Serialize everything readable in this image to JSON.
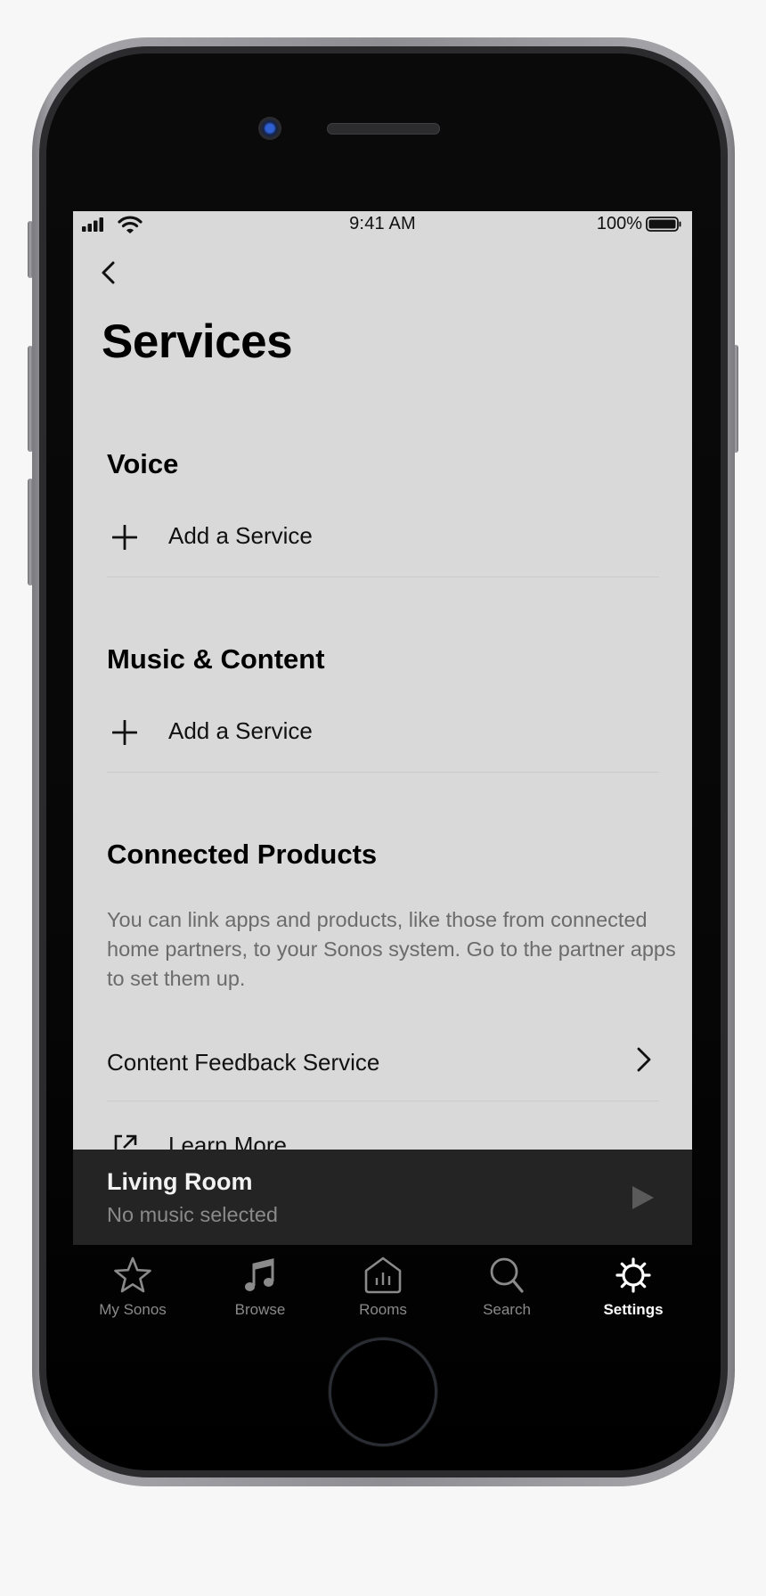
{
  "status_bar": {
    "time": "9:41 AM",
    "battery_percent": "100%",
    "signal_icon": "cellular-signal-icon",
    "wifi_icon": "wifi-icon",
    "battery_icon": "battery-full-icon"
  },
  "header": {
    "back_icon": "chevron-left-icon",
    "title": "Services"
  },
  "sections": {
    "voice": {
      "heading": "Voice",
      "add_label": "Add a Service",
      "add_icon": "plus-icon"
    },
    "music": {
      "heading": "Music & Content",
      "add_label": "Add a Service",
      "add_icon": "plus-icon"
    },
    "connected": {
      "heading": "Connected Products",
      "description": "You can link apps and products, like those from connected home partners, to your Sonos system. Go to the partner apps to set them up.",
      "items": [
        {
          "label": "Content Feedback Service",
          "icon": "chevron-right-icon"
        },
        {
          "label": "Learn More",
          "icon": "external-link-icon"
        }
      ]
    }
  },
  "mini_player": {
    "room": "Living Room",
    "status": "No music selected",
    "play_icon": "play-icon"
  },
  "tab_bar": {
    "tabs": [
      {
        "label": "My Sonos",
        "icon": "star-icon",
        "active": false
      },
      {
        "label": "Browse",
        "icon": "music-note-icon",
        "active": false
      },
      {
        "label": "Rooms",
        "icon": "rooms-house-icon",
        "active": false
      },
      {
        "label": "Search",
        "icon": "search-icon",
        "active": false
      },
      {
        "label": "Settings",
        "icon": "gear-icon",
        "active": true
      }
    ]
  },
  "colors": {
    "screen_bg": "#d9d9d9",
    "mini_player_bg": "#242424",
    "tab_bar_bg": "#000000",
    "tab_inactive": "#8a8a8a",
    "tab_active": "#ffffff",
    "description_text": "#6b6b6b"
  }
}
